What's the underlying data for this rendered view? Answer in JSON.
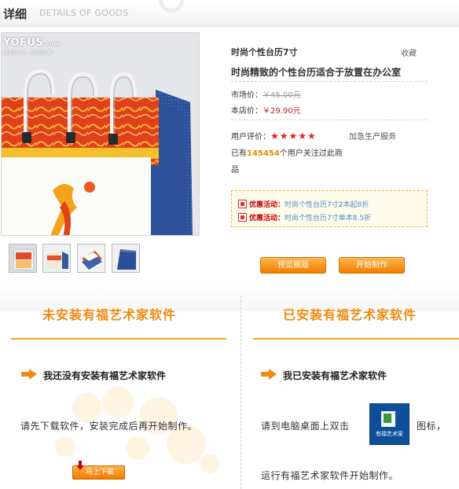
{
  "header": {
    "title": "详细",
    "subtitle": "DETAILS OF GOODS"
  },
  "gallery": {
    "logo_text": "YOFUS",
    "logo_domain": ".com",
    "logo_slogan": "精彩生活 有福自来!",
    "thumbnails": [
      "calendar-front",
      "calendar-side",
      "calendar-stack",
      "calendar-blue"
    ]
  },
  "product": {
    "name": "时尚个性台历7寸",
    "favorite": "收藏",
    "description": "时尚精致的个性台历适合于放置在办公室",
    "market_price_label": "市场价：",
    "market_price": "￥45.00元",
    "store_price_label": "本店价：",
    "store_price": "￥29.90元",
    "rating_label": "用户评价：",
    "rating_stars": "★★★★★",
    "rating_value": 5,
    "service": "加急生产服务",
    "followers_prefix": "已有",
    "followers_count": "145454",
    "followers_suffix": "个用户关注过此商",
    "followers_wrap": "品"
  },
  "promotions": [
    {
      "label": "优惠活动：",
      "link": "时尚个性台历7寸2本起8折"
    },
    {
      "label": "优惠活动：",
      "link": "时尚个性台历7寸单本8.5折"
    }
  ],
  "actions": {
    "preview": "预览模版",
    "start": "开始制作"
  },
  "not_installed": {
    "title": "未安装有福艺术家软件",
    "step": "我还没有安装有福艺术家软件",
    "instruction": "请先下载软件，安装完成后再开始制作。",
    "download_button": "马上下载"
  },
  "installed": {
    "title": "已安装有福艺术家软件",
    "step": "我已安装有福艺术家软件",
    "instruction_before": "请到电脑桌面上双击",
    "instruction_after": "图标，",
    "instruction_line2": "运行有福艺术家软件开始制作。",
    "icon_caption": "有福艺术家"
  },
  "colors": {
    "accent_orange": "#f08a10",
    "price_red": "#c81b1b",
    "link_blue": "#4a8fd0"
  }
}
